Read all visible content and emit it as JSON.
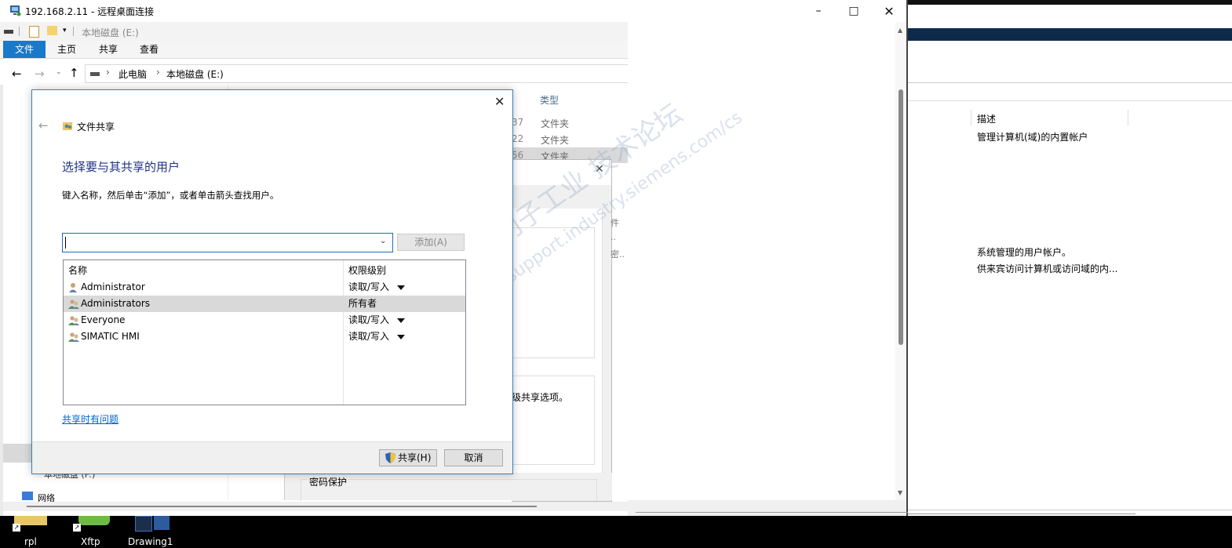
{
  "rdp": {
    "title": "192.168.2.11 - 远程桌面连接"
  },
  "explorer": {
    "qat_path": "本地磁盘 (E:)",
    "ribbon_tabs": [
      "文件",
      "主页",
      "共享",
      "查看"
    ],
    "breadcrumb": [
      "此电脑",
      "本地磁盘 (E:)"
    ],
    "col_type_header": "类型",
    "rows": [
      {
        "date_fragment": "37",
        "type": "文件夹"
      },
      {
        "date_fragment": "22",
        "type": "文件夹"
      },
      {
        "date_fragment": "56",
        "type": "文件夹"
      }
    ],
    "nav_items": [
      "本地磁盘 (F:)",
      "网络"
    ]
  },
  "dialog": {
    "header_title": "文件共享",
    "heading": "选择要与其共享的用户",
    "instruction": "键入名称，然后单击“添加”，或者单击箭头查找用户。",
    "name_input_value": "",
    "add_button": "添加(A)",
    "table_headers": {
      "name": "名称",
      "permission": "权限级别"
    },
    "users": [
      {
        "name": "Administrator",
        "permission": "读取/写入",
        "has_dropdown": true,
        "icon": "user-icon"
      },
      {
        "name": "Administrators",
        "permission": "所有者",
        "has_dropdown": false,
        "icon": "group-icon"
      },
      {
        "name": "Everyone",
        "permission": "读取/写入",
        "has_dropdown": true,
        "icon": "group-icon"
      },
      {
        "name": "SIMATIC HMI",
        "permission": "读取/写入",
        "has_dropdown": true,
        "icon": "group-icon"
      }
    ],
    "help_link": "共享时有问题",
    "share_button": "共享(H)",
    "cancel_button": "取消"
  },
  "bg_dialog": {
    "text_fragment": "级共享选项。",
    "side_chars": [
      "件",
      "..",
      "密.."
    ],
    "password_section": "密码保护"
  },
  "mmc": {
    "col_description": "描述",
    "descriptions": [
      "管理计算机(域)的内置帐户",
      "系统管理的用户帐户。",
      "供来宾访问计算机或访问域的内..."
    ]
  },
  "taskbar": {
    "items": [
      "rpl",
      "Xftp",
      "Drawing1"
    ]
  },
  "watermark": {
    "line1": "西门子工业 技术论坛",
    "line2": "support.industry.siemens.com/cs"
  },
  "colors": {
    "accent": "#1979ca",
    "heading": "#1e3287",
    "link": "#0066cc",
    "selected_row": "#d9d9d9"
  }
}
